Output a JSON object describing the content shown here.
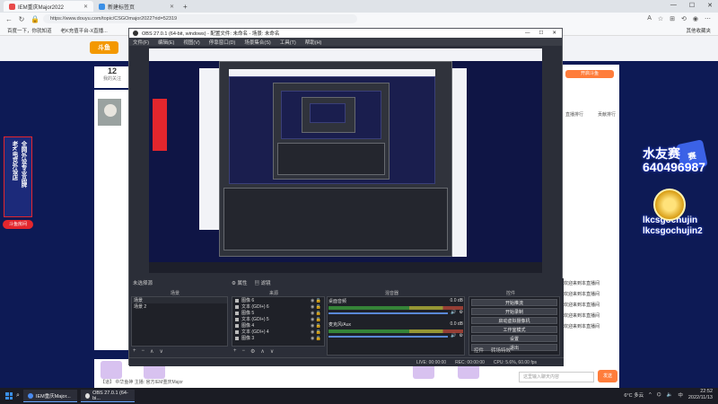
{
  "browser": {
    "tabs": [
      {
        "label": "IEM重庆Major2022",
        "active": true
      },
      {
        "label": "新建标签页",
        "active": false
      }
    ],
    "new_tab_symbol": "+",
    "window_controls": [
      "—",
      "☐",
      "✕"
    ],
    "url": "https://www.douyu.com/topic/CSGOmajor2022?rid=52319",
    "bookmarks": [
      "百度一下，你就知道",
      "老K充值平台-X直播..."
    ],
    "bookmarks_right": "其他收藏夹"
  },
  "douyu": {
    "logo": "斗鱼",
    "left_card": {
      "number": "12",
      "label": "我的关注"
    },
    "vertical_banner": [
      "老K电竞外设店",
      "全网外设专业品牌"
    ],
    "douyu_badge": "斗鱼房间",
    "right_panel": {
      "button": "开启斗鱼",
      "tabs": [
        "直播排行",
        "贡献排行"
      ],
      "list": [
        "欢迎来到本直播间",
        "欢迎来到本直播间",
        "欢迎来到本直播间",
        "欢迎来到本直播间",
        "欢迎来到本直播间"
      ]
    },
    "overlay": {
      "line1": "水友赛",
      "line2": "640496987",
      "name1": "lkcsgochujin",
      "name2": "lkcsgochujin2"
    },
    "chat_placeholder": "这里输入聊天内容",
    "send_label": "发送",
    "bottom_links": "【道】 中华鱼神 主播: 官方IEM重庆Major"
  },
  "obs": {
    "title": "OBS 27.0.1 (64-bit, windows) - 配置文件: 未命名 - 场景: 未命名",
    "menu": [
      "文件(F)",
      "编辑(E)",
      "视图(V)",
      "停靠窗口(D)",
      "场景集合(S)",
      "工具(T)",
      "帮助(H)"
    ],
    "no_source_selected": "未选择源",
    "dock_headers": {
      "scenes": "场景",
      "sources": "来源",
      "mixer": "混音器",
      "controls": "控件"
    },
    "properties_label": "属性",
    "filters_label": "滤镜",
    "scenes": [
      "场景",
      "场景 2"
    ],
    "sources": [
      {
        "icon": "image-icon",
        "label": "图像 6"
      },
      {
        "icon": "text-icon",
        "label": "文本 (GDI+) 6"
      },
      {
        "icon": "image-icon",
        "label": "图像 5"
      },
      {
        "icon": "text-icon",
        "label": "文本 (GDI+) 5"
      },
      {
        "icon": "image-icon",
        "label": "图像 4"
      },
      {
        "icon": "text-icon",
        "label": "文本 (GDI+) 4"
      },
      {
        "icon": "image-icon",
        "label": "图像 3"
      }
    ],
    "mixer": [
      {
        "name": "桌面音频",
        "db": "0.0 dB"
      },
      {
        "name": "麦克风/Aux",
        "db": "0.0 dB"
      }
    ],
    "controls": [
      "开始推流",
      "开始录制",
      "启动虚拟摄像机",
      "工作室模式",
      "设置",
      "退出"
    ],
    "controls_tabs": [
      "控件",
      "转场特效"
    ],
    "dock_buttons": [
      "+",
      "−",
      "∧",
      "∨"
    ],
    "status": {
      "live": "LIVE: 00:00:00",
      "rec": "REC: 00:00:00",
      "cpu": "CPU: 5.6%, 60.00 fps"
    }
  },
  "taskbar": {
    "items": [
      "IEM重庆Major...",
      "OBS 27.0.1 (64-bi..."
    ],
    "weather": "6°C 多云",
    "ime": "中",
    "time": "22:52",
    "date": "2022/11/13"
  },
  "colors": {
    "douyu_orange": "#ff7d3b",
    "douyu_red": "#e3262d",
    "stream_bg": "#0d1a55",
    "obs_dark": "#2b2e38"
  }
}
